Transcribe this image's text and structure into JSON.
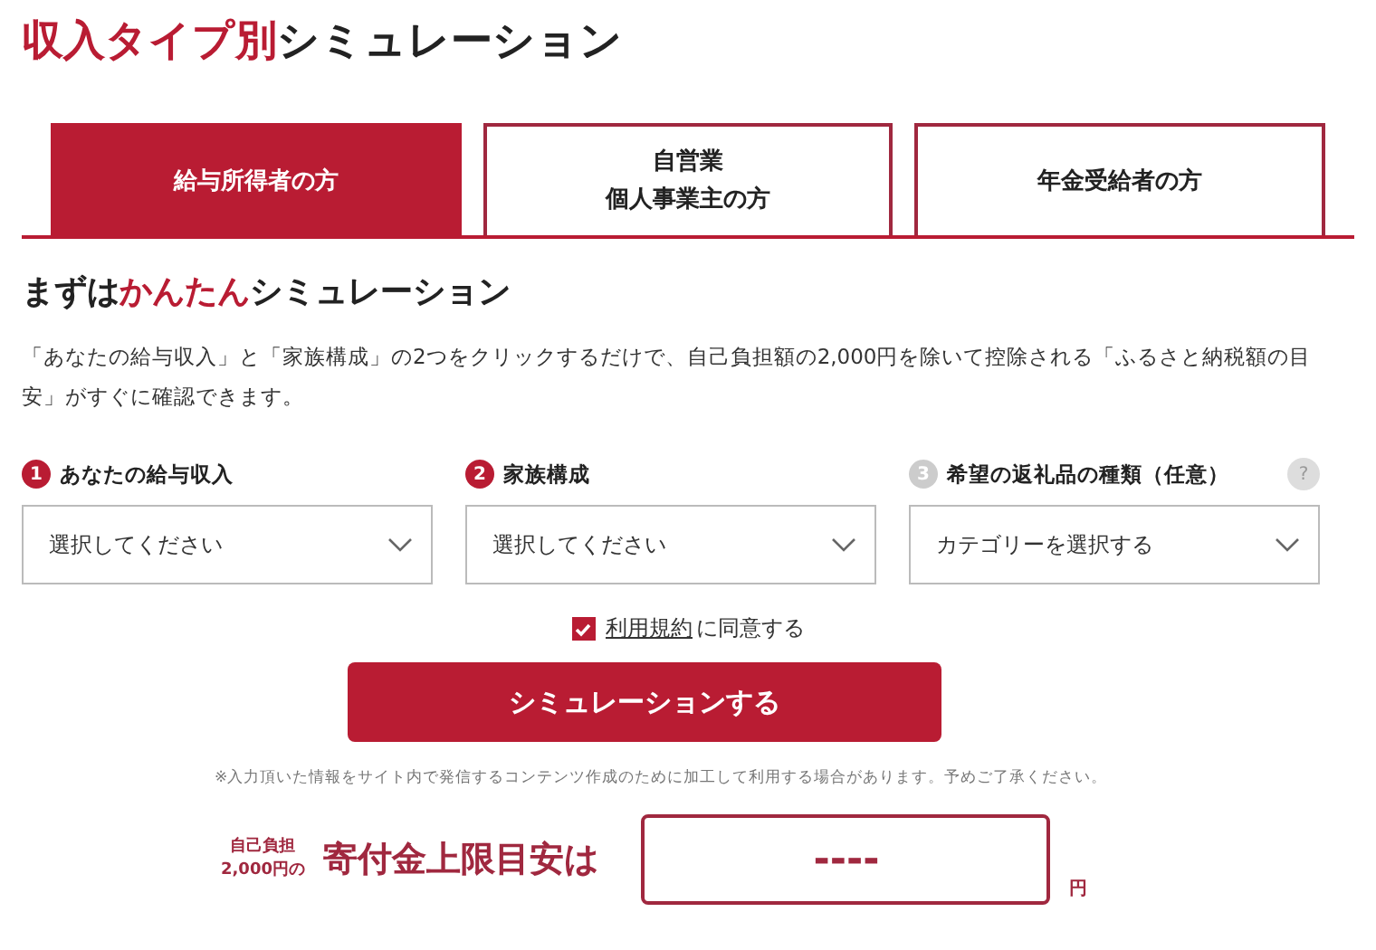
{
  "title": [
    {
      "text": "収入タイプ別",
      "accent": true
    },
    {
      "text": "シミュレーション",
      "accent": false
    }
  ],
  "tabs": [
    {
      "lines": [
        "給与所得者の方"
      ],
      "selected": true
    },
    {
      "lines": [
        "自営業",
        "個人事業主の方"
      ],
      "selected": false
    },
    {
      "lines": [
        "年金受給者の方"
      ],
      "selected": false
    }
  ],
  "heading": [
    {
      "text": "まずは",
      "accent": false
    },
    {
      "text": "かんたん",
      "accent": true
    },
    {
      "text": "シミュレーション",
      "accent": false
    }
  ],
  "description": "「あなたの給与収入」と「家族構成」の2つをクリックするだけで、自己負担額の2,000円を除いて控除される「ふるさと納税額の目安」がすぐに確認できます。",
  "steps": [
    {
      "number": "1",
      "label": "あなたの給与収入",
      "active": true,
      "placeholder": "選択してください"
    },
    {
      "number": "2",
      "label": "家族構成",
      "active": true,
      "placeholder": "選択してください"
    },
    {
      "number": "3",
      "label": "希望の返礼品の種類（任意）",
      "active": false,
      "placeholder": "カテゴリーを選択する",
      "help": "?"
    }
  ],
  "agree": {
    "checked": true,
    "link": "利用規約",
    "text": "に同意する"
  },
  "submit": "シミュレーションする",
  "note": "※入力頂いた情報をサイト内で発信するコンテンツ作成のために加工して利用する場合があります。予めご了承ください。",
  "result": {
    "prefix_lines": [
      "自己負担",
      "2,000円の"
    ],
    "label": "寄付金上限目安は",
    "value": "----",
    "unit": "円"
  }
}
